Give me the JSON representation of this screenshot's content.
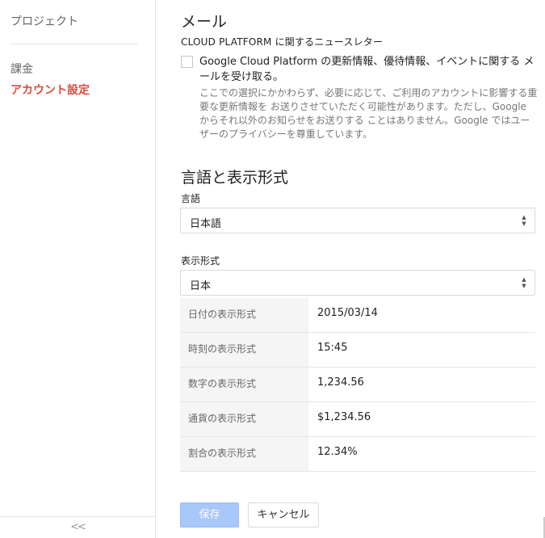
{
  "sidebar": {
    "items": [
      {
        "label": "プロジェクト"
      },
      {
        "label": "課金"
      },
      {
        "label": "アカウント設定"
      }
    ],
    "collapse_glyph": "<<"
  },
  "email": {
    "title": "メール",
    "subtitle": "CLOUD PLATFORM に関するニュースレター",
    "checkbox_label": "Google Cloud Platform の更新情報、優待情報、イベントに関する メールを受け取る。",
    "description": "ここでの選択にかかわらず、必要に応じて、ご利用のアカウントに影響する重要な更新情報を お送りさせていただく可能性があります。ただし、Google からそれ以外のお知らせをお送りする ことはありません。Google ではユーザーのプライバシーを尊重しています。",
    "checked": false
  },
  "locale": {
    "title": "言語と表示形式",
    "language_label": "言語",
    "language_value": "日本語",
    "format_label": "表示形式",
    "format_value": "日本",
    "formats": [
      {
        "key": "日付の表示形式",
        "value": "2015/03/14"
      },
      {
        "key": "時刻の表示形式",
        "value": "15:45"
      },
      {
        "key": "数字の表示形式",
        "value": "1,234.56"
      },
      {
        "key": "通貨の表示形式",
        "value": "$1,234.56"
      },
      {
        "key": "割合の表示形式",
        "value": "12.34%"
      }
    ]
  },
  "actions": {
    "save_label": "保存",
    "cancel_label": "キャンセル"
  },
  "colors": {
    "accent_red": "#dd4b39",
    "save_button_disabled": "#a8c7fa"
  }
}
